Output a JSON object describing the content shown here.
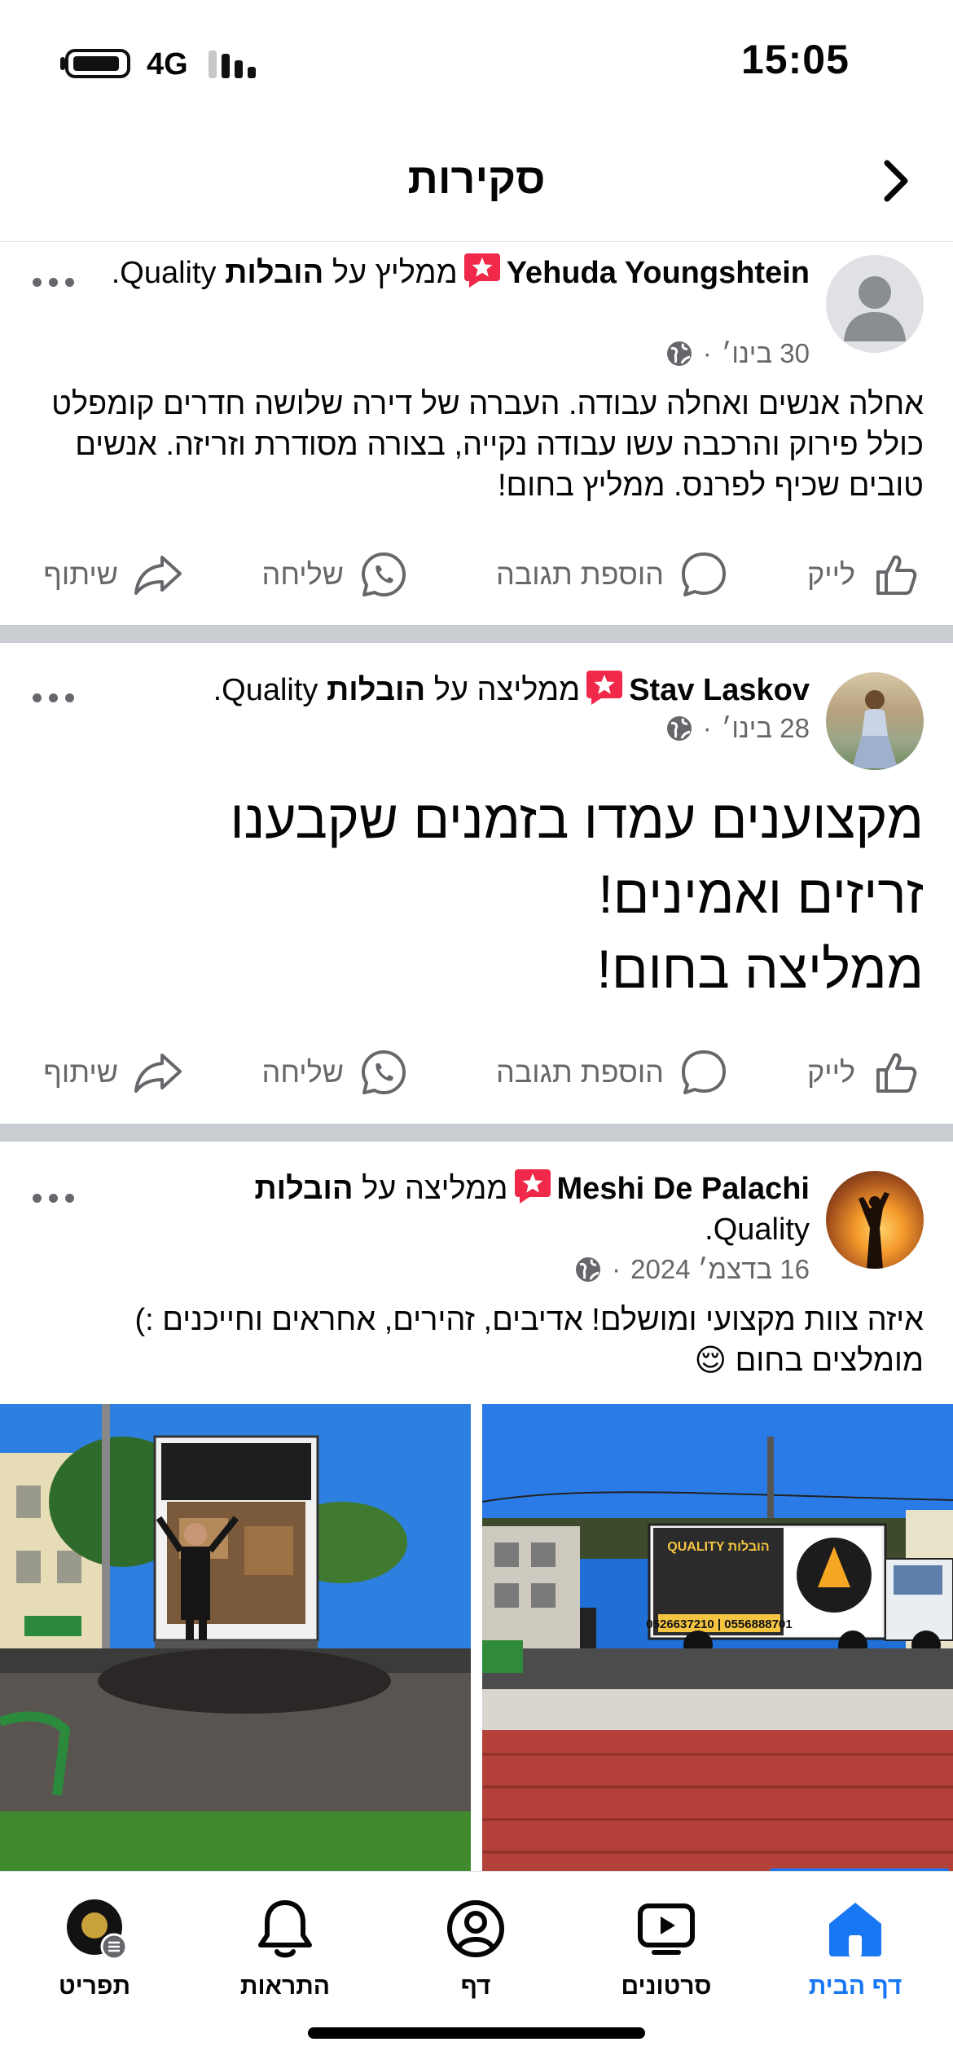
{
  "status_bar": {
    "time": "15:05",
    "network": "4G"
  },
  "header": {
    "title": "סקירות"
  },
  "recommend_verb_m": "ממליץ על",
  "recommend_verb_f": "ממליצה על",
  "page_name_bold": "הובלות",
  "page_name_rest": "Quality",
  "actions": {
    "like": "לייק",
    "comment": "הוספת תגובה",
    "send": "שליחה",
    "share": "שיתוף"
  },
  "posts": [
    {
      "author": "Yehuda Youngshtein",
      "verb": "ממליץ על",
      "date": "30 בינו׳",
      "text": "אחלה אנשים ואחלה עבודה. העברה של דירה שלושה חדרים קומפלט כולל פירוק והרכבה עשו עבודה נקייה, בצורה מסודרת וזריזה. אנשים טובים שכיף לפרנס. ממליץ בחום!"
    },
    {
      "author": "Stav Laskov",
      "verb": "ממליצה על",
      "date": "28 בינו׳",
      "text_lines": [
        "מקצוענים עמדו בזמנים שקבענו",
        "זריזים ואמינים!",
        "ממליצה בחום!"
      ]
    },
    {
      "author": "Meshi De Palachi",
      "verb": "ממליצה על",
      "date": "16 בדצמ׳ 2024",
      "text_line1": "איזה צוות מקצועי ומושלם! אדיבים, זהירים, אחראים וחייכנים :)",
      "text_line2": "מומלצים בחום 😌"
    }
  ],
  "truck_sign": {
    "brand": "QUALITY הובלות",
    "phones": "0526637210 | 0556888701"
  },
  "tabs": [
    {
      "label": "דף הבית",
      "icon": "home-icon",
      "active": true
    },
    {
      "label": "סרטונים",
      "icon": "video-icon"
    },
    {
      "label": "דף",
      "icon": "profile-icon"
    },
    {
      "label": "התראות",
      "icon": "bell-icon"
    },
    {
      "label": "תפריט",
      "icon": "menu-avatar-icon"
    }
  ],
  "colors": {
    "accent": "#1877f2",
    "recommend_badge": "#f02849",
    "secondary_text": "#65676b",
    "separator": "#c9ccd1"
  }
}
